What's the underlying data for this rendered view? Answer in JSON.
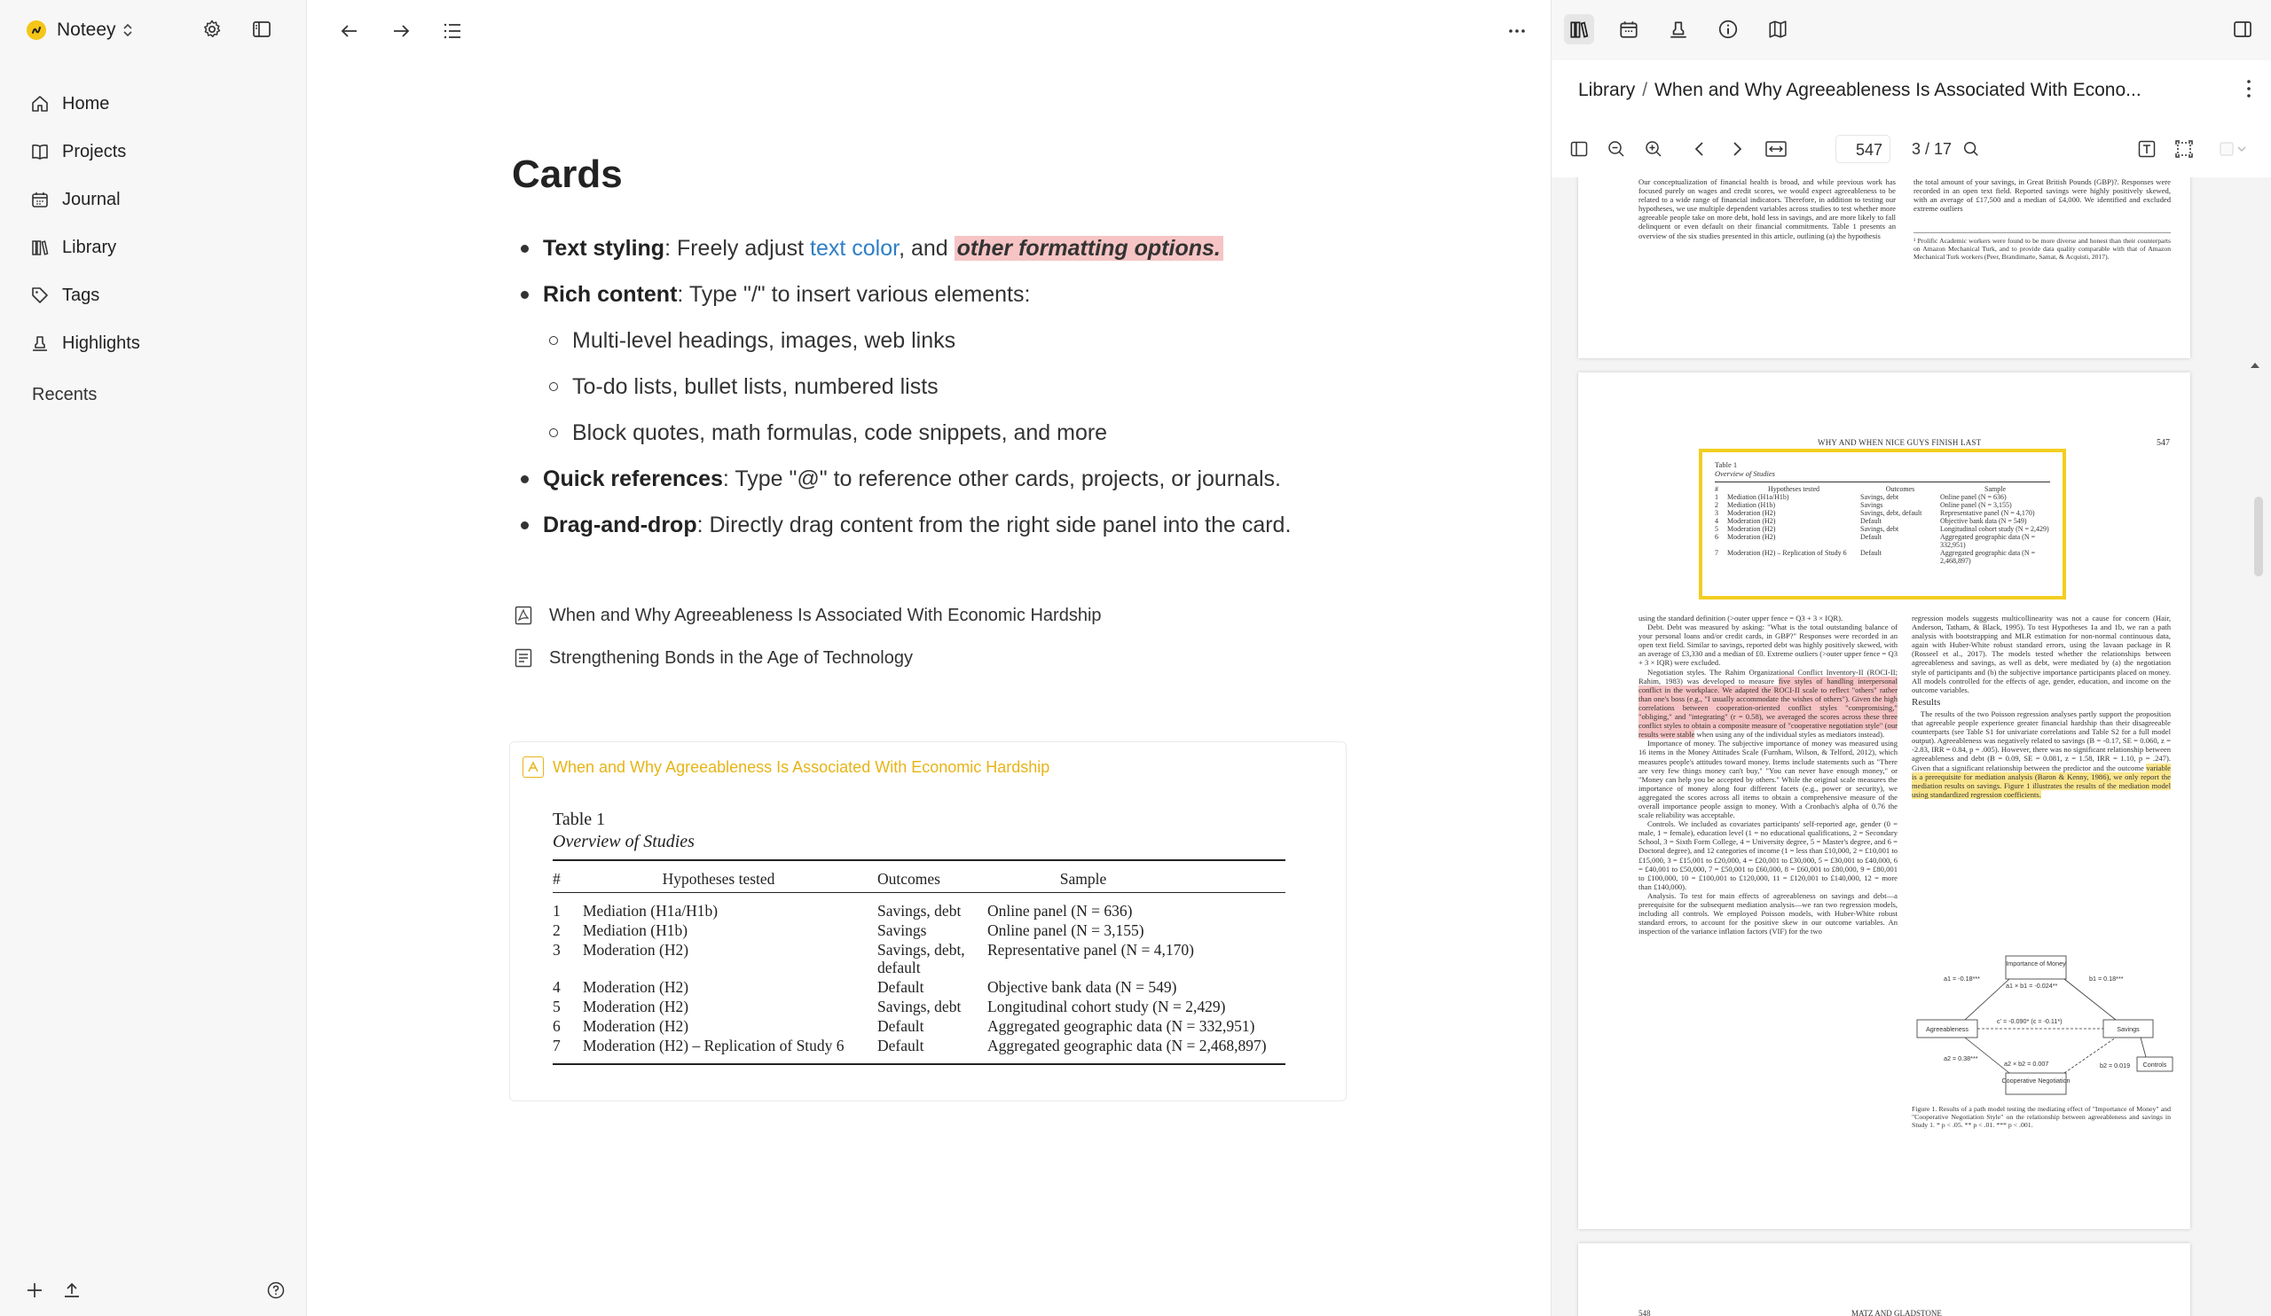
{
  "app": {
    "name": "Noteey"
  },
  "sidebar": {
    "nav": [
      {
        "label": "Home",
        "icon": "home-icon"
      },
      {
        "label": "Projects",
        "icon": "book-icon"
      },
      {
        "label": "Journal",
        "icon": "calendar-icon"
      },
      {
        "label": "Library",
        "icon": "library-icon"
      },
      {
        "label": "Tags",
        "icon": "tag-icon"
      },
      {
        "label": "Highlights",
        "icon": "highlighter-icon"
      }
    ],
    "recents_label": "Recents"
  },
  "main": {
    "title": "Cards",
    "bullets": {
      "b1": {
        "bold": "Text styling",
        "text1": ": Freely adjust ",
        "link": "text color",
        "text2": ", and ",
        "highlight": "other formatting options."
      },
      "b2": {
        "bold": "Rich content",
        "text": ": Type \"/\" to insert various elements:"
      },
      "sub": [
        "Multi-level headings, images, web links",
        "To-do lists, bullet lists, numbered lists",
        "Block quotes, math formulas, code snippets, and more"
      ],
      "b3": {
        "bold": "Quick references",
        "text": ": Type \"@\" to reference other cards, projects, or journals."
      },
      "b4": {
        "bold": "Drag-and-drop",
        "text": ": Directly drag content from the right side panel into the card."
      }
    },
    "references": [
      {
        "label": "When and Why Agreeableness Is Associated With Economic Hardship",
        "icon": "pdf-icon"
      },
      {
        "label": "Strengthening Bonds in the Age of Technology",
        "icon": "document-icon"
      }
    ],
    "card": {
      "title": "When and Why Agreeableness Is Associated With Economic Hardship",
      "table_caption": "Table 1",
      "table_subtitle": "Overview of Studies",
      "columns": [
        "#",
        "Hypotheses tested",
        "Outcomes",
        "Sample"
      ],
      "rows": [
        [
          "1",
          "Mediation (H1a/H1b)",
          "Savings, debt",
          "Online panel (N = 636)"
        ],
        [
          "2",
          "Mediation (H1b)",
          "Savings",
          "Online panel (N = 3,155)"
        ],
        [
          "3",
          "Moderation (H2)",
          "Savings, debt, default",
          "Representative panel (N = 4,170)"
        ],
        [
          "4",
          "Moderation (H2)",
          "Default",
          "Objective bank data (N = 549)"
        ],
        [
          "5",
          "Moderation (H2)",
          "Savings, debt",
          "Longitudinal cohort study (N = 2,429)"
        ],
        [
          "6",
          "Moderation (H2)",
          "Default",
          "Aggregated geographic data (N = 332,951)"
        ],
        [
          "7",
          "Moderation (H2) – Replication of Study 6",
          "Default",
          "Aggregated geographic data (N = 2,468,897)"
        ]
      ]
    }
  },
  "right_panel": {
    "breadcrumb": {
      "root": "Library",
      "separator": "/",
      "current": "When and Why Agreeableness Is Associated With Econo..."
    },
    "viewer": {
      "page_input": "547",
      "page_total": "3 / 17"
    },
    "pdf": {
      "top_left": "Our conceptualization of financial health is broad, and while previous work has focused purely on wages and credit scores, we would expect agreeableness to be related to a wide range of financial indicators. Therefore, in addition to testing our hypotheses, we use multiple dependent variables across studies to test whether more agreeable people take on more debt, hold less in savings, and are more likely to fall delinquent or even default on their financial commitments. Table 1 presents an overview of the six studies presented in this article, outlining (a) the hypothesis",
      "top_right_1": "the total amount of your savings, in Great British Pounds (GBP)?. Responses were recorded in an open text field. Reported savings were highly positively skewed, with an average of £17,500 and a median of £4,000. We identified and excluded extreme outliers",
      "top_right_fn": "¹ Prolific Academic workers were found to be more diverse and honest than their counterparts on Amazon Mechanical Turk, and to provide data quality comparable with that of Amazon Mechanical Turk workers (Peer, Brandimarte, Samat, & Acquisti, 2017).",
      "running_head": "WHY AND WHEN NICE GUYS FINISH LAST",
      "page_number": "547",
      "left_col_1": "using the standard definition (>outer upper fence = Q3 + 3 × IQR).",
      "debt": "Debt. Debt was measured by asking: \"What is the total outstanding balance of your personal loans and/or credit cards, in GBP?\" Responses were recorded in an open text field. Similar to savings, reported debt was highly positively skewed, with an average of £3,330 and a median of £0. Extreme outliers (>outer upper fence = Q3 + 3 × IQR) were excluded.",
      "neg_intro": "Negotiation styles. The Rahim Organizational Conflict Inventory-II (ROCI-II; Rahim, 1983) was developed to measure",
      "neg_hl": "five styles of handling interpersonal conflict in the workplace. We adapted the ROCI-II scale to reflect \"others\" rather than one's boss (e.g., \"I usually accommodate the wishes of others\"). Given the high correlations between cooperation-oriented conflict styles \"compromising,\" \"obliging,\" and \"integrating\" (r = 0.58), we averaged the scores across these three conflict styles to obtain a composite measure of \"cooperative negotiation style\" (our results were stable",
      "neg_tail": " when using any of the individual styles as mediators instead).",
      "money": "Importance of money. The subjective importance of money was measured using 16 items in the Money Attitudes Scale (Furnham, Wilson, & Telford, 2012), which measures people's attitudes toward money. Items include statements such as \"There are very few things money can't buy,\" \"You can never have enough money,\" or \"Money can help you be accepted by others.\" While the original scale measures the importance of money along four different facets (e.g., power or security), we aggregated the scores across all items to obtain a comprehensive measure of the overall importance people assign to money. With a Cronbach's alpha of 0.76 the scale reliability was acceptable.",
      "controls": "Controls. We included as covariates participants' self-reported age, gender (0 = male, 1 = female), education level (1 = no educational qualifications, 2 = Secondary School, 3 = Sixth Form College, 4 = University degree, 5 = Master's degree, and 6 = Doctoral degree), and 12 categories of income (1 = less than £10,000, 2 = £10,001 to £15,000, 3 = £15,001 to £20,000, 4 = £20,001 to £30,000, 5 = £30,001 to £40,000, 6 = £40,001 to £50,000, 7 = £50,001 to £60,000, 8 = £60,001 to £80,000, 9 = £80,001 to £100,000, 10 = £100,001 to £120,000, 11 = £120,001 to £140,000, 12 = more than £140,000).",
      "analysis": "Analysis. To test for main effects of agreeableness on savings and debt—a prerequisite for the subsequent mediation analysis—we ran two regression models, including all controls. We employed Poisson models, with Huber-White robust standard errors, to account for the positive skew in our outcome variables. An inspection of the variance inflation factors (VIF) for the two",
      "right_col_1": "regression models suggests multicollinearity was not a cause for concern (Hair, Anderson, Tatham, & Black, 1995). To test Hypotheses 1a and 1b, we ran a path analysis with bootstrapping and MLR estimation for non-normal continuous data, again with Huber-White robust standard errors, using the lavaan package in R (Rosseel et al., 2017). The models tested whether the relationships between agreeableness and savings, as well as debt, were mediated by (a) the negotiation style of participants and (b) the subjective importance participants placed on money. All models controlled for the effects of age, gender, education, and income on the outcome variables.",
      "results_heading": "Results",
      "results": "The results of the two Poisson regression analyses partly support the proposition that agreeable people experience greater financial hardship than their disagreeable counterparts (see Table S1 for univariate correlations and Table S2 for a full model output). Agreeableness was negatively related to savings (B = -0.17, SE = 0.060, z = -2.83, IRR = 0.84, p = .005). However, there was no significant relationship between agreeableness and debt (B = 0.09, SE = 0.081, z = 1.58, IRR = 1.10, p = .247). Given that a significant relationship between the predictor and the outcome",
      "results_hl": "variable is a prerequisite for mediation analysis (Baron & Kenny, 1986), we only report the mediation results on savings. Figure 1 illustrates the results of the mediation model using standardized regression coefficients.",
      "fig": {
        "node_money": "Importance of Money",
        "node_agree": "Agreeableness",
        "node_savings": "Savings",
        "node_coop": "Cooperative Negotiation",
        "node_controls": "Controls",
        "a1": "a1 = -0.18***",
        "b1": "b1 = 0.18***",
        "ab1": "a1 × b1 = -0.024**",
        "c": "c' = -0.090* (c = -0.11*)",
        "a2": "a2 = 0.38***",
        "ab2": "a2 × b2 = 0.007",
        "b2": "b2 = 0.019"
      },
      "fig_caption": "Figure 1. Results of a path model testing the mediating effect of \"Importance of Money\" and \"Cooperative Negotiation Style\" on the relationship between agreeableness and savings in Study 1. * p < .05. ** p < .01. *** p < .001.",
      "mini_table": {
        "caption": "Table 1",
        "subtitle": "Overview of Studies",
        "columns": [
          "#",
          "Hypotheses tested",
          "Outcomes",
          "Sample"
        ],
        "rows": [
          [
            "1",
            "Mediation (H1a/H1b)",
            "Savings, debt",
            "Online panel (N = 636)"
          ],
          [
            "2",
            "Mediation (H1b)",
            "Savings",
            "Online panel (N = 3,155)"
          ],
          [
            "3",
            "Moderation (H2)",
            "Savings, debt, default",
            "Representative panel (N = 4,170)"
          ],
          [
            "4",
            "Moderation (H2)",
            "Default",
            "Objective bank data (N = 549)"
          ],
          [
            "5",
            "Moderation (H2)",
            "Savings, debt",
            "Longitudinal cohort study (N = 2,429)"
          ],
          [
            "6",
            "Moderation (H2)",
            "Default",
            "Aggregated geographic data (N = 332,951)"
          ],
          [
            "7",
            "Moderation (H2) – Replication of Study 6",
            "Default",
            "Aggregated geographic data (N = 2,468,897)"
          ]
        ]
      },
      "next_page_num": "548",
      "next_running_head": "MATZ AND GLADSTONE"
    }
  },
  "colors": {
    "accent_yellow": "#f3cd1f",
    "highlight_red": "#f6c4c4",
    "highlight_yellow": "#fbe68e",
    "link_blue": "#2f7fc8"
  }
}
